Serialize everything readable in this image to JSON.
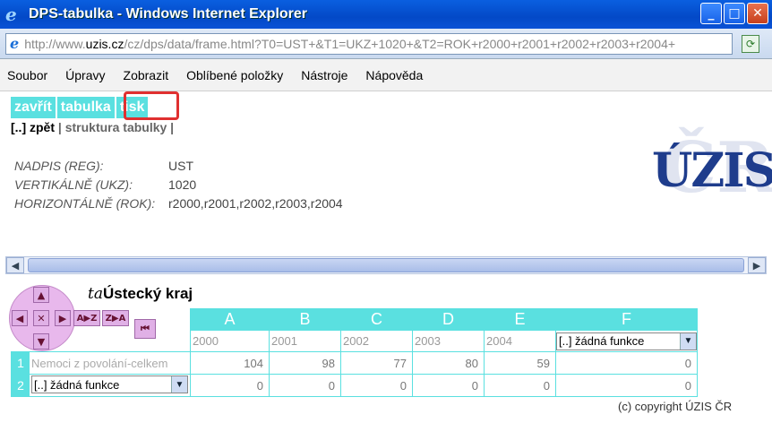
{
  "window": {
    "title": "DPS-tabulka - Windows Internet Explorer",
    "controls": {
      "minimize": "_",
      "maximize": "□",
      "close": "✕"
    }
  },
  "address": {
    "url_prefix": "http://www.",
    "url_domain": "uzis.cz",
    "url_suffix": "/cz/dps/data/frame.html?T0=UST+&T1=UKZ+1020+&T2=ROK+r2000+r2001+r2002+r2003+r2004+"
  },
  "menu": {
    "items": [
      "Soubor",
      "Úpravy",
      "Zobrazit",
      "Oblíbené položky",
      "Nástroje",
      "Nápověda"
    ]
  },
  "toolbar": {
    "close_label": "zavřít",
    "table_label": "tabulka",
    "print_label": "tisk"
  },
  "subnav": {
    "back": "[..] zpět",
    "sep1": " | ",
    "structure": "struktura tabulky",
    "sep2": " |"
  },
  "logo": {
    "text": "ÚZIS",
    "subtext": "ČR"
  },
  "params": [
    {
      "key": "NADPIS (REG):",
      "value": "UST"
    },
    {
      "key": "VERTIKÁLNĚ (UKZ):",
      "value": "1020"
    },
    {
      "key": "HORIZONTÁLNĚ (ROK):",
      "value": "r2000,r2001,r2002,r2003,r2004"
    }
  ],
  "nav": {
    "up": "▲",
    "down": "▼",
    "left": "◀",
    "right": "▶",
    "center": "✕",
    "sort_az": "A▶Z",
    "sort_za": "Z▶A",
    "first": "⏮"
  },
  "region": {
    "prefix": "ta",
    "name": "Ústecký kraj"
  },
  "table": {
    "columns": [
      "A",
      "B",
      "C",
      "D",
      "E",
      "F"
    ],
    "years": [
      "2000",
      "2001",
      "2002",
      "2003",
      "2004"
    ],
    "func_label": "[..] žádná funkce",
    "rows": [
      {
        "num": "1",
        "name": "Nemoci z povolání-celkem",
        "values": [
          "104",
          "98",
          "77",
          "80",
          "59",
          "0"
        ]
      },
      {
        "num": "2",
        "name": "[..] žádná funkce",
        "values": [
          "0",
          "0",
          "0",
          "0",
          "0",
          "0"
        ]
      }
    ]
  },
  "copyright": "(c) copyright ÚZIS ČR"
}
